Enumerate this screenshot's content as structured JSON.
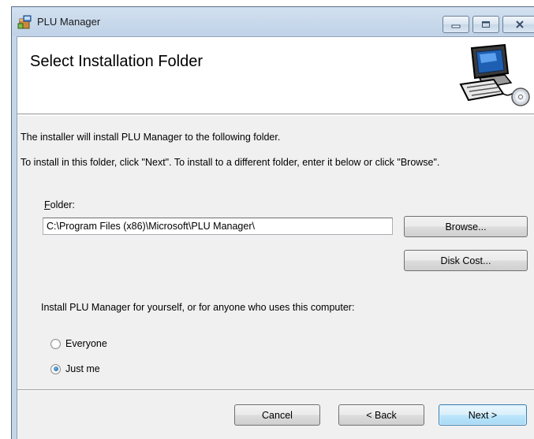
{
  "window": {
    "title": "PLU Manager",
    "icons": {
      "app": "installer-package-icon",
      "minimize": "minimize-icon",
      "maximize": "maximize-icon",
      "close": "close-icon"
    }
  },
  "banner": {
    "title": "Select Installation Folder",
    "image": "computer-disc-icon"
  },
  "body": {
    "line1": "The installer will install PLU Manager to the following folder.",
    "line2": "To install in this folder, click \"Next\". To install to a different folder, enter it below or click \"Browse\"."
  },
  "folder": {
    "label_accel": "F",
    "label_rest": "older:",
    "value": "C:\\Program Files (x86)\\Microsoft\\PLU Manager\\"
  },
  "buttons": {
    "browse": "Browse...",
    "disk_cost": "Disk Cost...",
    "cancel": "Cancel",
    "back": "< Back",
    "next": "Next >"
  },
  "install_for": {
    "prompt": "Install PLU Manager for yourself, or for anyone who uses this computer:",
    "options": [
      {
        "label": "Everyone",
        "checked": false
      },
      {
        "label": "Just me",
        "checked": true
      }
    ]
  }
}
